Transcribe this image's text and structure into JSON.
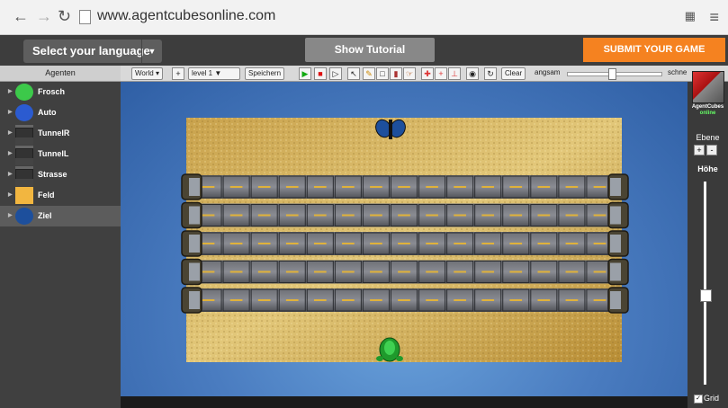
{
  "browser": {
    "url": "www.agentcubesonline.com",
    "back_icon": "arrow-left",
    "forward_icon": "arrow-right",
    "reload_icon": "reload",
    "menu_icon": "hamburger"
  },
  "topbar": {
    "language_label": "Select your language",
    "tutorial_label": "Show Tutorial",
    "submit_label": "SUBMIT YOUR GAME",
    "submit_color": "#f58220"
  },
  "toolbar": {
    "agents_header": "Agenten",
    "world_label": "World",
    "plus_label": "+",
    "level_label": "level 1",
    "save_label": "Speichern",
    "clear_label": "Clear",
    "speed_slow": "angsam",
    "speed_fast": "schne",
    "speed_value": 0.48
  },
  "agents": [
    {
      "name": "Frosch",
      "icon": "frog-icon",
      "selected": false
    },
    {
      "name": "Auto",
      "icon": "car-icon",
      "selected": false
    },
    {
      "name": "TunnelR",
      "icon": "tunnel-icon",
      "selected": false
    },
    {
      "name": "TunnelL",
      "icon": "tunnel-icon",
      "selected": false
    },
    {
      "name": "Strasse",
      "icon": "road-icon",
      "selected": false
    },
    {
      "name": "Feld",
      "icon": "field-icon",
      "selected": false
    },
    {
      "name": "Ziel",
      "icon": "butterfly-icon",
      "selected": true
    }
  ],
  "right_panel": {
    "logo_line1": "AgentCubes",
    "logo_line2": "online",
    "ebene_label": "Ebene",
    "ebene_plus": "+",
    "ebene_minus": "-",
    "hoehe_label": "Höhe",
    "hoehe_value": 0.55,
    "grid_label": "Grid",
    "grid_checked": true
  },
  "world": {
    "road_rows": 5,
    "road_columns": 15
  }
}
